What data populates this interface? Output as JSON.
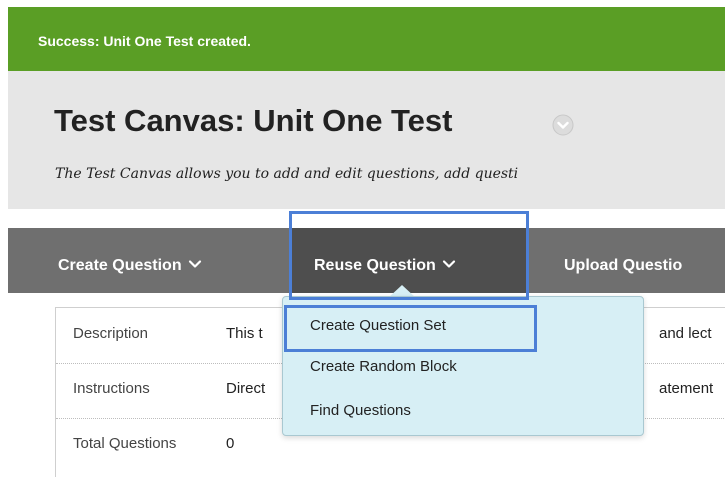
{
  "notification": {
    "text": "Success: Unit One Test created."
  },
  "header": {
    "title": "Test Canvas: Unit One Test",
    "subtitle": "The Test Canvas allows you to add and edit questions, add questi"
  },
  "action_bar": {
    "create_question": "Create Question",
    "reuse_question": "Reuse Question",
    "upload_questions": "Upload Questio"
  },
  "dropdown": {
    "items": [
      {
        "label": "Create Question Set"
      },
      {
        "label": "Create Random Block"
      },
      {
        "label": "Find Questions"
      }
    ]
  },
  "info_table": {
    "rows": [
      {
        "label": "Description",
        "value_left": "This t",
        "value_right": "and lect"
      },
      {
        "label": "Instructions",
        "value_left": "Direct",
        "value_right": "atement"
      },
      {
        "label": "Total Questions",
        "value_left": "0"
      }
    ]
  },
  "colors": {
    "success_green": "#5a9e25",
    "action_bar_gray": "#6f6f6f",
    "active_tab": "#4e4e4e",
    "dropdown_bg": "#d7eff5",
    "highlight_blue": "#4c7fd6"
  }
}
